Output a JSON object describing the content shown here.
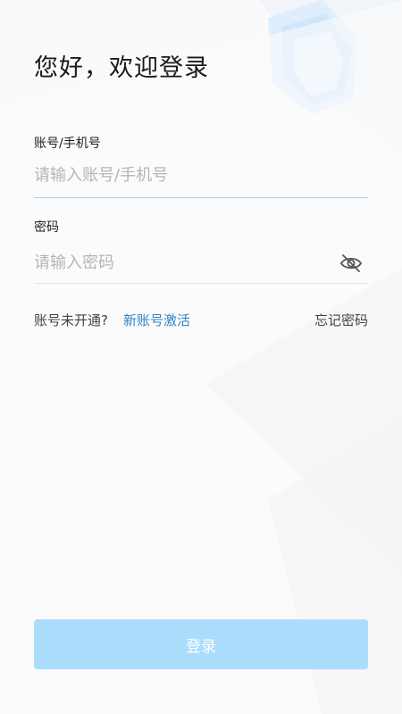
{
  "header": {
    "greeting": "您好，欢迎登录"
  },
  "form": {
    "account": {
      "label": "账号/手机号",
      "value": "",
      "placeholder": "请输入账号/手机号"
    },
    "password": {
      "label": "密码",
      "value": "",
      "placeholder": "请输入密码",
      "visibility_icon": "eye-off-icon"
    }
  },
  "links": {
    "not_activated": "账号未开通?",
    "activate": "新账号激活",
    "forgot": "忘记密码"
  },
  "actions": {
    "login_label": "登录"
  },
  "colors": {
    "accent": "#2e86c8",
    "button_bg": "#acdcfb",
    "active_underline": "#a9d2f2"
  }
}
